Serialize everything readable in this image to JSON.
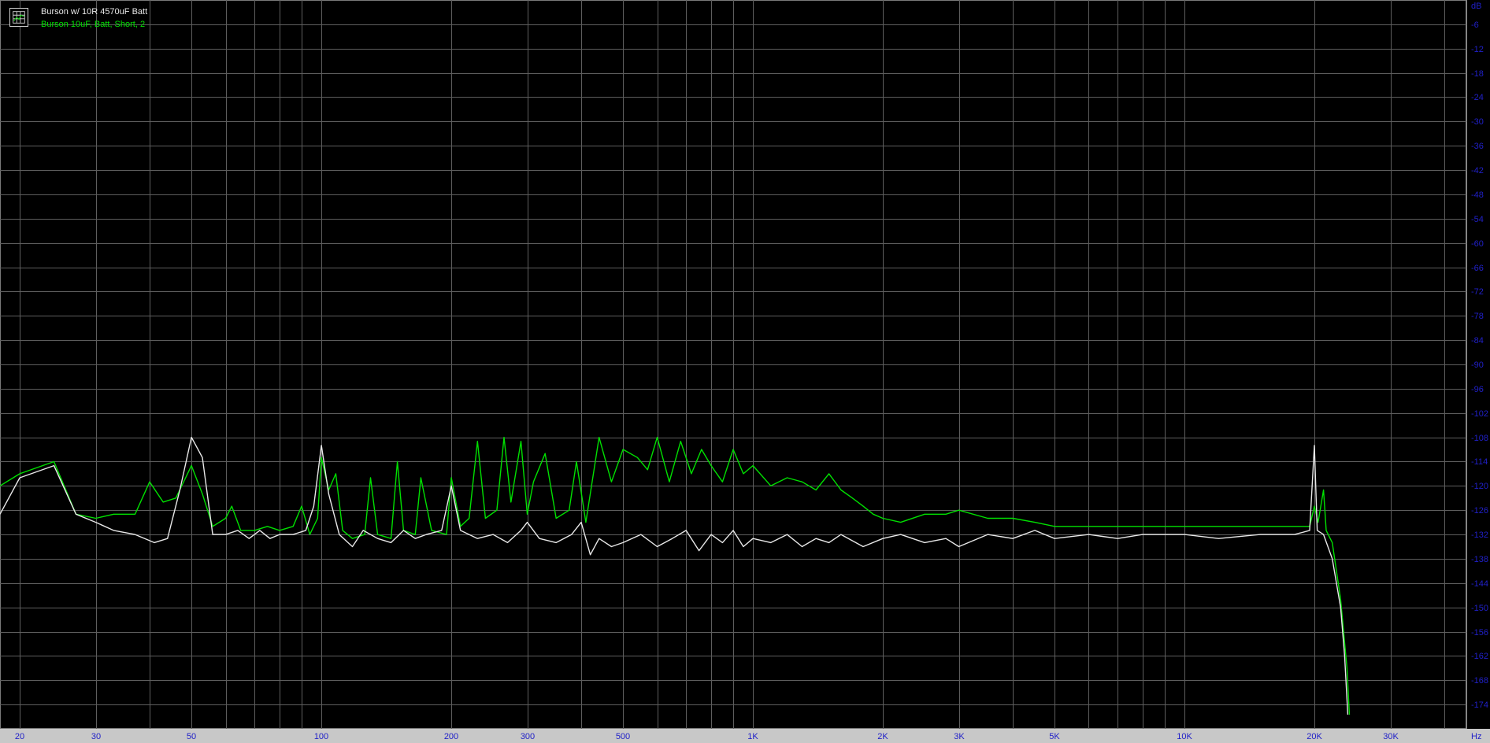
{
  "chart_data": {
    "type": "line",
    "xscale": "log",
    "xlim": [
      18,
      45000
    ],
    "ylim": [
      -180,
      0
    ],
    "grid": true,
    "x_unit": "Hz",
    "y_unit": "dB",
    "x_ticks": [
      {
        "v": 20,
        "label": "20"
      },
      {
        "v": 30,
        "label": "30"
      },
      {
        "v": 50,
        "label": "50"
      },
      {
        "v": 100,
        "label": "100"
      },
      {
        "v": 200,
        "label": "200"
      },
      {
        "v": 300,
        "label": "300"
      },
      {
        "v": 500,
        "label": "500"
      },
      {
        "v": 1000,
        "label": "1K"
      },
      {
        "v": 2000,
        "label": "2K"
      },
      {
        "v": 3000,
        "label": "3K"
      },
      {
        "v": 5000,
        "label": "5K"
      },
      {
        "v": 10000,
        "label": "10K"
      },
      {
        "v": 20000,
        "label": "20K"
      },
      {
        "v": 30000,
        "label": "30K"
      }
    ],
    "x_grid": [
      20,
      30,
      40,
      50,
      60,
      70,
      80,
      90,
      100,
      200,
      300,
      400,
      500,
      600,
      700,
      800,
      900,
      1000,
      2000,
      3000,
      4000,
      5000,
      6000,
      7000,
      8000,
      9000,
      10000,
      20000,
      30000,
      40000
    ],
    "y_ticks": [
      -6,
      -12,
      -18,
      -24,
      -30,
      -36,
      -42,
      -48,
      -54,
      -60,
      -66,
      -72,
      -78,
      -84,
      -90,
      -96,
      -102,
      -108,
      -114,
      -120,
      -126,
      -132,
      -138,
      -144,
      -150,
      -156,
      -162,
      -168,
      -174
    ],
    "legend": "top-left",
    "series": [
      {
        "name": "Burson w/ 10R 4570uF Batt",
        "color": "#e8e8e8",
        "points": [
          [
            18,
            -127
          ],
          [
            20,
            -118
          ],
          [
            24,
            -115
          ],
          [
            27,
            -127
          ],
          [
            30,
            -129
          ],
          [
            33,
            -131
          ],
          [
            37,
            -132
          ],
          [
            41,
            -134
          ],
          [
            44,
            -133
          ],
          [
            47,
            -121
          ],
          [
            50,
            -108
          ],
          [
            53,
            -113
          ],
          [
            56,
            -132
          ],
          [
            60,
            -132
          ],
          [
            64,
            -131
          ],
          [
            68,
            -133
          ],
          [
            72,
            -131
          ],
          [
            76,
            -133
          ],
          [
            80,
            -132
          ],
          [
            86,
            -132
          ],
          [
            92,
            -131
          ],
          [
            96,
            -125
          ],
          [
            100,
            -110
          ],
          [
            104,
            -122
          ],
          [
            110,
            -132
          ],
          [
            118,
            -135
          ],
          [
            125,
            -131
          ],
          [
            135,
            -133
          ],
          [
            145,
            -134
          ],
          [
            155,
            -131
          ],
          [
            165,
            -133
          ],
          [
            175,
            -132
          ],
          [
            190,
            -131
          ],
          [
            200,
            -120
          ],
          [
            210,
            -131
          ],
          [
            230,
            -133
          ],
          [
            250,
            -132
          ],
          [
            270,
            -134
          ],
          [
            290,
            -131
          ],
          [
            300,
            -129
          ],
          [
            320,
            -133
          ],
          [
            350,
            -134
          ],
          [
            380,
            -132
          ],
          [
            400,
            -129
          ],
          [
            420,
            -137
          ],
          [
            440,
            -133
          ],
          [
            470,
            -135
          ],
          [
            500,
            -134
          ],
          [
            550,
            -132
          ],
          [
            600,
            -135
          ],
          [
            650,
            -133
          ],
          [
            700,
            -131
          ],
          [
            750,
            -136
          ],
          [
            800,
            -132
          ],
          [
            850,
            -134
          ],
          [
            900,
            -131
          ],
          [
            950,
            -135
          ],
          [
            1000,
            -133
          ],
          [
            1100,
            -134
          ],
          [
            1200,
            -132
          ],
          [
            1300,
            -135
          ],
          [
            1400,
            -133
          ],
          [
            1500,
            -134
          ],
          [
            1600,
            -132
          ],
          [
            1800,
            -135
          ],
          [
            2000,
            -133
          ],
          [
            2200,
            -132
          ],
          [
            2500,
            -134
          ],
          [
            2800,
            -133
          ],
          [
            3000,
            -135
          ],
          [
            3500,
            -132
          ],
          [
            4000,
            -133
          ],
          [
            4500,
            -131
          ],
          [
            5000,
            -133
          ],
          [
            6000,
            -132
          ],
          [
            7000,
            -133
          ],
          [
            8000,
            -132
          ],
          [
            10000,
            -132
          ],
          [
            12000,
            -133
          ],
          [
            15000,
            -132
          ],
          [
            18000,
            -132
          ],
          [
            19500,
            -131
          ],
          [
            20000,
            -110
          ],
          [
            20300,
            -131
          ],
          [
            21000,
            -132
          ],
          [
            22000,
            -138
          ],
          [
            23000,
            -150
          ],
          [
            23500,
            -162
          ],
          [
            24000,
            -180
          ]
        ]
      },
      {
        "name": "Burson 10uF, Batt, Short, 2",
        "color": "#00e000",
        "points": [
          [
            18,
            -120
          ],
          [
            20,
            -117
          ],
          [
            24,
            -114
          ],
          [
            27,
            -127
          ],
          [
            30,
            -128
          ],
          [
            33,
            -127
          ],
          [
            37,
            -127
          ],
          [
            40,
            -119
          ],
          [
            43,
            -124
          ],
          [
            46,
            -123
          ],
          [
            50,
            -115
          ],
          [
            53,
            -122
          ],
          [
            56,
            -130
          ],
          [
            60,
            -128
          ],
          [
            62,
            -125
          ],
          [
            65,
            -131
          ],
          [
            70,
            -131
          ],
          [
            75,
            -130
          ],
          [
            80,
            -131
          ],
          [
            86,
            -130
          ],
          [
            90,
            -125
          ],
          [
            94,
            -132
          ],
          [
            98,
            -128
          ],
          [
            100,
            -113
          ],
          [
            104,
            -121
          ],
          [
            108,
            -117
          ],
          [
            112,
            -131
          ],
          [
            118,
            -133
          ],
          [
            126,
            -132
          ],
          [
            130,
            -118
          ],
          [
            135,
            -132
          ],
          [
            145,
            -133
          ],
          [
            150,
            -114
          ],
          [
            155,
            -131
          ],
          [
            165,
            -132
          ],
          [
            170,
            -118
          ],
          [
            180,
            -131
          ],
          [
            195,
            -132
          ],
          [
            200,
            -118
          ],
          [
            210,
            -130
          ],
          [
            220,
            -128
          ],
          [
            230,
            -109
          ],
          [
            240,
            -128
          ],
          [
            255,
            -126
          ],
          [
            265,
            -108
          ],
          [
            275,
            -124
          ],
          [
            290,
            -109
          ],
          [
            300,
            -127
          ],
          [
            310,
            -119
          ],
          [
            330,
            -112
          ],
          [
            350,
            -128
          ],
          [
            375,
            -126
          ],
          [
            390,
            -114
          ],
          [
            410,
            -129
          ],
          [
            440,
            -108
          ],
          [
            470,
            -119
          ],
          [
            500,
            -111
          ],
          [
            540,
            -113
          ],
          [
            570,
            -116
          ],
          [
            600,
            -108
          ],
          [
            640,
            -119
          ],
          [
            680,
            -109
          ],
          [
            720,
            -117
          ],
          [
            760,
            -111
          ],
          [
            800,
            -115
          ],
          [
            850,
            -119
          ],
          [
            900,
            -111
          ],
          [
            950,
            -117
          ],
          [
            1000,
            -115
          ],
          [
            1100,
            -120
          ],
          [
            1200,
            -118
          ],
          [
            1300,
            -119
          ],
          [
            1400,
            -121
          ],
          [
            1500,
            -117
          ],
          [
            1600,
            -121
          ],
          [
            1700,
            -123
          ],
          [
            1800,
            -125
          ],
          [
            1900,
            -127
          ],
          [
            2000,
            -128
          ],
          [
            2200,
            -129
          ],
          [
            2500,
            -127
          ],
          [
            2800,
            -127
          ],
          [
            3000,
            -126
          ],
          [
            3500,
            -128
          ],
          [
            4000,
            -128
          ],
          [
            4500,
            -129
          ],
          [
            5000,
            -130
          ],
          [
            6000,
            -130
          ],
          [
            7000,
            -130
          ],
          [
            8000,
            -130
          ],
          [
            10000,
            -130
          ],
          [
            12000,
            -130
          ],
          [
            15000,
            -130
          ],
          [
            18000,
            -130
          ],
          [
            19500,
            -130
          ],
          [
            20000,
            -125
          ],
          [
            20400,
            -129
          ],
          [
            21000,
            -121
          ],
          [
            21300,
            -131
          ],
          [
            22000,
            -134
          ],
          [
            23000,
            -148
          ],
          [
            23800,
            -165
          ],
          [
            24200,
            -180
          ]
        ]
      }
    ]
  }
}
